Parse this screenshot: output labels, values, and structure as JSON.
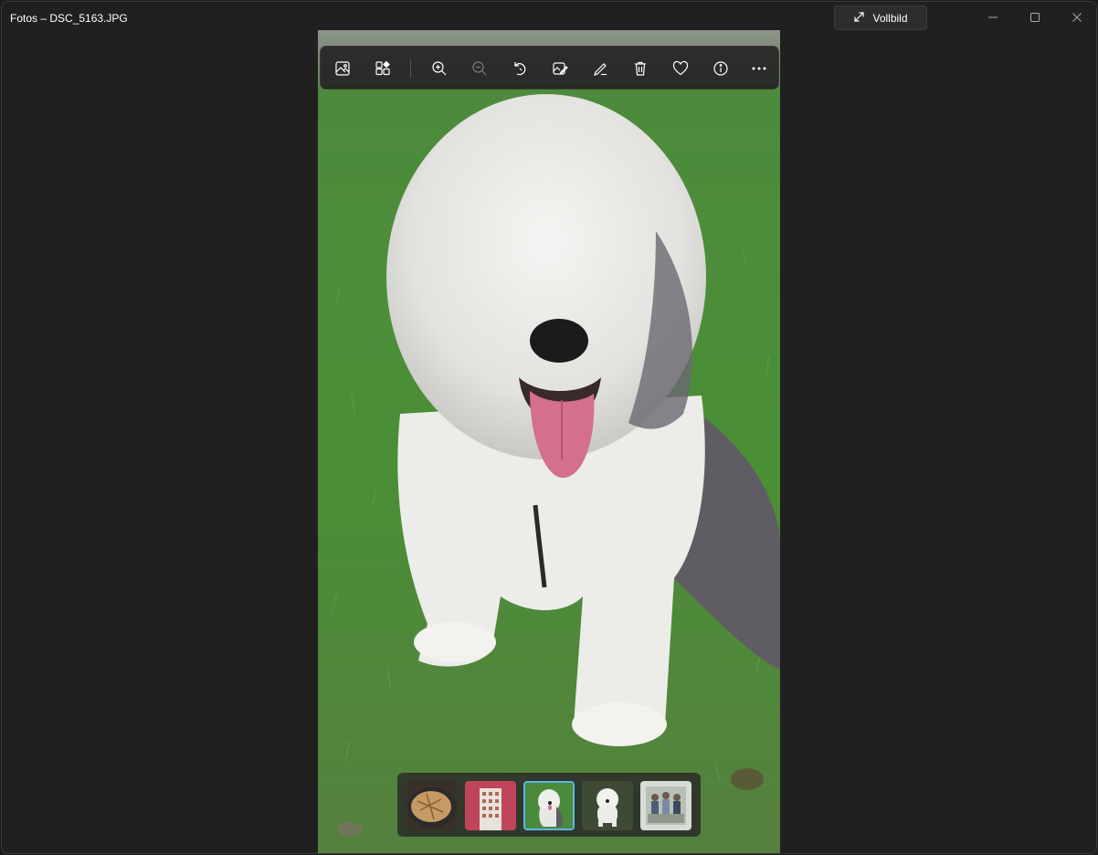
{
  "window": {
    "title": "Fotos – DSC_5163.JPG",
    "fullscreen_label": "Vollbild"
  },
  "toolbar": {
    "buttons": [
      {
        "name": "view-photo",
        "icon": "image-icon"
      },
      {
        "name": "gallery",
        "icon": "grid-icon"
      },
      {
        "name": "zoom-in",
        "icon": "zoom-in-icon"
      },
      {
        "name": "zoom-out",
        "icon": "zoom-out-icon"
      },
      {
        "name": "rotate",
        "icon": "rotate-icon"
      },
      {
        "name": "edit-image",
        "icon": "edit-image-icon"
      },
      {
        "name": "draw",
        "icon": "pen-icon"
      },
      {
        "name": "delete",
        "icon": "trash-icon"
      },
      {
        "name": "favorite",
        "icon": "heart-icon"
      },
      {
        "name": "info",
        "icon": "info-icon"
      },
      {
        "name": "more",
        "icon": "more-icon"
      }
    ]
  },
  "filmstrip": {
    "thumbnails": [
      {
        "name": "thumb-bread"
      },
      {
        "name": "thumb-building"
      },
      {
        "name": "thumb-dog-sitting",
        "selected": true
      },
      {
        "name": "thumb-dog-standing"
      },
      {
        "name": "thumb-people"
      }
    ]
  },
  "colors": {
    "background": "#202020",
    "accent": "#5ab8e6",
    "grass": "#4f8f3a"
  }
}
